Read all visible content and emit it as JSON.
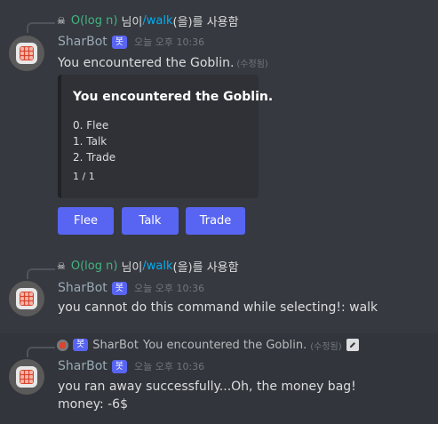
{
  "messages": [
    {
      "reply": {
        "skull": "☠",
        "user": "O(log n)",
        "text_mid": " 님이 ",
        "command": "/walk",
        "text_end": "(을)를 사용함"
      },
      "author": "SharBot",
      "bot_tag": "봇",
      "timestamp": "오늘 오후 10:36",
      "content": "You encountered the Goblin.",
      "edited": "(수정됨)",
      "embed": {
        "title": "You encountered the Goblin.",
        "lines": [
          "0. Flee",
          "1. Talk",
          "2. Trade"
        ],
        "footer": "1 / 1"
      },
      "buttons": [
        "Flee",
        "Talk",
        "Trade"
      ]
    },
    {
      "reply": {
        "skull": "☠",
        "user": "O(log n)",
        "text_mid": " 님이 ",
        "command": "/walk",
        "text_end": "(을)를 사용함"
      },
      "author": "SharBot",
      "bot_tag": "봇",
      "timestamp": "오늘 오후 10:36",
      "content": "you cannot do this command while selecting!: walk"
    },
    {
      "reply": {
        "bot_tag": "봇",
        "user": "SharBot",
        "text": "You encountered the Goblin.",
        "edited": "(수정됨)"
      },
      "author": "SharBot",
      "bot_tag": "봇",
      "timestamp": "오늘 오후 10:36",
      "content_lines": [
        "you ran away successfully...Oh, the money bag!",
        "money: -6$"
      ]
    }
  ],
  "colors": {
    "background": "#36393f",
    "blurple": "#5865f2",
    "reply_user": "#43b581",
    "command": "#00aff4"
  },
  "icons": [
    "skull-icon",
    "sharbot-avatar",
    "edit-icon"
  ]
}
